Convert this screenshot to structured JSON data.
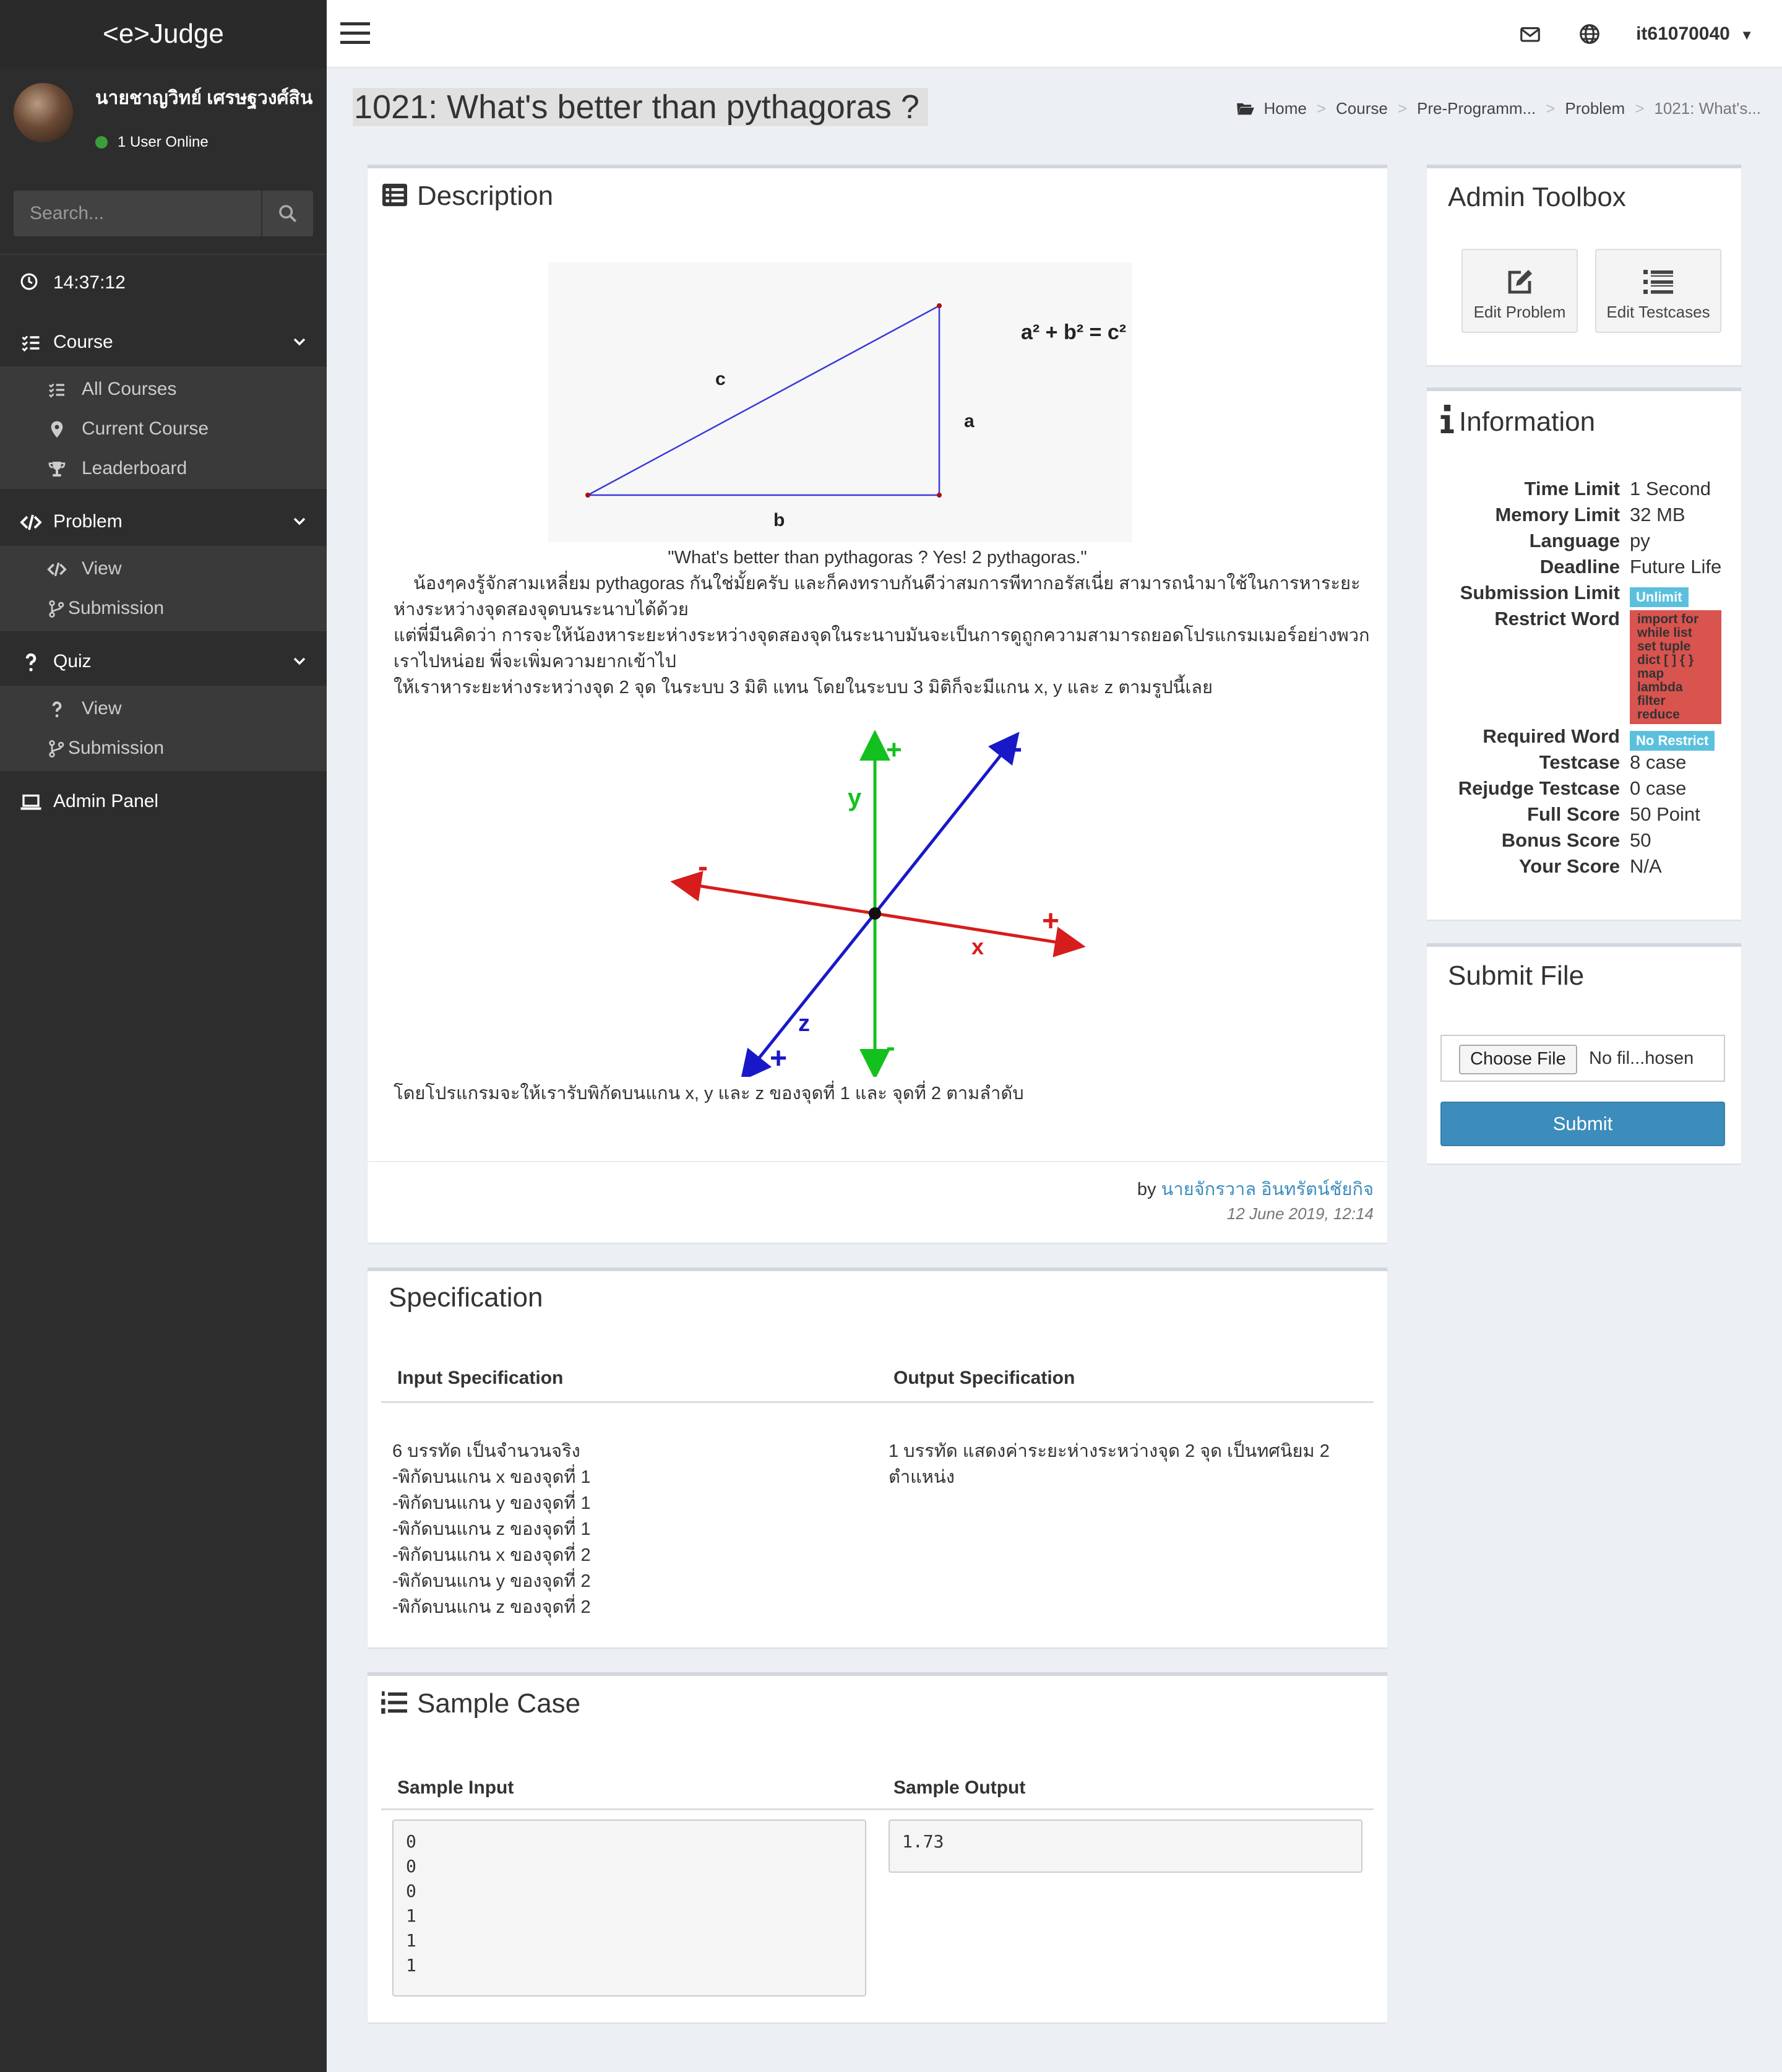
{
  "app": {
    "logo": "<e>Judge"
  },
  "user": {
    "name": "นายชาญวิทย์ เศรษฐวงศ์สิน",
    "online_text": "1 User Online"
  },
  "search": {
    "placeholder": "Search..."
  },
  "clock": "14:37:12",
  "sidebar": {
    "course": {
      "label": "Course",
      "items": [
        "All Courses",
        "Current Course",
        "Leaderboard"
      ]
    },
    "problem": {
      "label": "Problem",
      "items": [
        "View",
        "Submission"
      ]
    },
    "quiz": {
      "label": "Quiz",
      "items": [
        "View",
        "Submission"
      ]
    },
    "admin": "Admin Panel"
  },
  "topbar": {
    "username": "it61070040"
  },
  "page": {
    "title": "1021: What's better than pythagoras ?"
  },
  "breadcrumb": [
    "Home",
    "Course",
    "Pre-Programm...",
    "Problem",
    "1021: What's..."
  ],
  "description": {
    "header": "Description",
    "figure1": {
      "label_c": "c",
      "label_a": "a",
      "label_b": "b",
      "formula": "a² + b² = c²"
    },
    "quote": "\"What's better than pythagoras ? Yes! 2 pythagoras.\"",
    "line1": "น้องๆคงรู้จักสามเหลี่ยม pythagoras กันใช่มั้ยครับ และก็คงทราบกันดีว่าสมการพีทากอรัสเนี่ย สามารถนำมาใช้ในการหาระยะ",
    "line2": "ห่างระหว่างจุดสองจุดบนระนาบได้ด้วย",
    "line3": "แต่พี่มีนคิดว่า การจะให้น้องหาระยะห่างระหว่างจุดสองจุดในระนาบมันจะเป็นการดูถูกความสามารถยอดโปรแกรมเมอร์อย่างพวก",
    "line4": "เราไปหน่อย พี่จะเพิ่มความยากเข้าไป",
    "line5": "ให้เราหาระยะห่างระหว่างจุด 2 จุด ในระบบ 3 มิติ แทน โดยในระบบ 3 มิติก็จะมีแกน x, y และ z ตามรูปนี้เลย",
    "figure2": {
      "y": "y",
      "x": "x",
      "z": "z",
      "plus": "+",
      "minus": "-"
    },
    "line6": "โดยโปรแกรมจะให้เรารับพิกัดบนแกน x, y และ z ของจุดที่ 1 และ จุดที่ 2 ตามลำดับ",
    "by": "by",
    "author": "นายจักรวาล อินทรัตน์ชัยกิจ",
    "date": "12 June 2019, 12:14"
  },
  "specification": {
    "header": "Specification",
    "input_header": "Input Specification",
    "output_header": "Output Specification",
    "input_lines": [
      "6 บรรทัด เป็นจำนวนจริง",
      "-พิกัดบนแกน x ของจุดที่ 1",
      "-พิกัดบนแกน y ของจุดที่ 1",
      "-พิกัดบนแกน z ของจุดที่ 1",
      "-พิกัดบนแกน x ของจุดที่ 2",
      "-พิกัดบนแกน y ของจุดที่ 2",
      "-พิกัดบนแกน z ของจุดที่ 2"
    ],
    "output_lines": [
      "1 บรรทัด แสดงค่าระยะห่างระหว่างจุด 2 จุด เป็นทศนิยม 2",
      "ตำแหน่ง"
    ]
  },
  "sample": {
    "header": "Sample Case",
    "input_header": "Sample Input",
    "output_header": "Sample Output",
    "input": "0\n0\n0\n1\n1\n1",
    "output": "1.73"
  },
  "admin_toolbox": {
    "header": "Admin Toolbox",
    "edit_problem": "Edit Problem",
    "edit_testcases": "Edit Testcases"
  },
  "information": {
    "header": "Information",
    "rows": [
      {
        "k": "Time Limit",
        "v": "1 Second"
      },
      {
        "k": "Memory Limit",
        "v": "32 MB"
      },
      {
        "k": "Language",
        "v": "py"
      },
      {
        "k": "Deadline",
        "v": "Future Life"
      },
      {
        "k": "Submission Limit",
        "v": "Unlimit"
      },
      {
        "k": "Restrict Word",
        "v": "import for while list set tuple dict [ ] { } map lambda filter reduce"
      },
      {
        "k": "Required Word",
        "v": "No Restrict"
      },
      {
        "k": "Testcase",
        "v": "8 case"
      },
      {
        "k": "Rejudge Testcase",
        "v": "0 case"
      },
      {
        "k": "Full Score",
        "v": "50 Point"
      },
      {
        "k": "Bonus Score",
        "v": "50"
      },
      {
        "k": "Your Score",
        "v": "N/A"
      }
    ],
    "restrict_words": [
      "import for",
      "while list",
      "set tuple",
      "dict [ ] { }",
      "map",
      "lambda",
      "filter",
      "reduce"
    ]
  },
  "submit_file": {
    "header": "Submit File",
    "choose": "Choose File",
    "no_file": "No fil...hosen",
    "submit": "Submit"
  },
  "colors": {
    "sidebar": "#2d2d2d",
    "accent": "#3c8dbc",
    "badge_blue": "#5bc0de",
    "badge_red": "#d9534f",
    "link": "#3c8dbc"
  }
}
